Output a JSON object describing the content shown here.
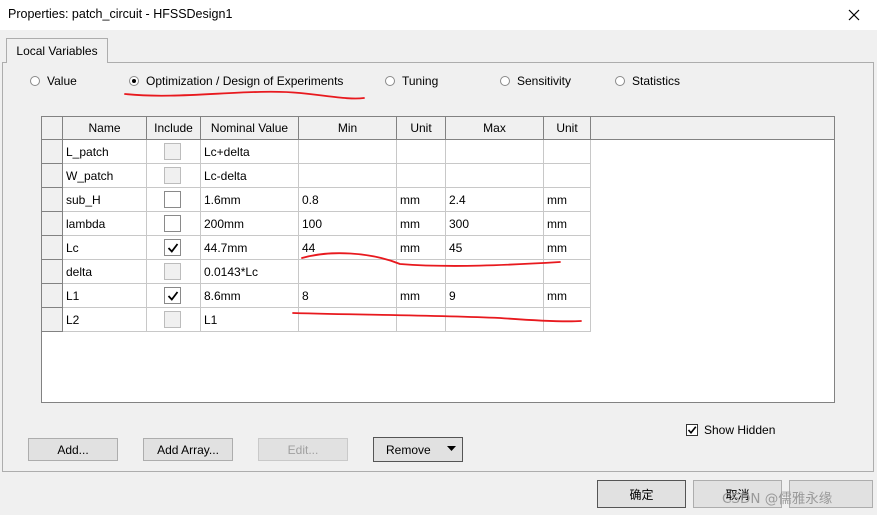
{
  "window": {
    "title": "Properties: patch_circuit - HFSSDesign1"
  },
  "tabs": [
    {
      "label": "Local Variables",
      "active": true
    }
  ],
  "modes": [
    {
      "label": "Value",
      "selected": false
    },
    {
      "label": "Optimization / Design of Experiments",
      "selected": true
    },
    {
      "label": "Tuning",
      "selected": false
    },
    {
      "label": "Sensitivity",
      "selected": false
    },
    {
      "label": "Statistics",
      "selected": false
    }
  ],
  "table": {
    "columns": [
      "Name",
      "Include",
      "Nominal Value",
      "Min",
      "Unit",
      "Max",
      "Unit"
    ],
    "rows": [
      {
        "name": "L_patch",
        "include": false,
        "include_enabled": false,
        "nominal": "Lc+delta",
        "min": "",
        "min_unit": "",
        "max": "",
        "max_unit": ""
      },
      {
        "name": "W_patch",
        "include": false,
        "include_enabled": false,
        "nominal": "Lc-delta",
        "min": "",
        "min_unit": "",
        "max": "",
        "max_unit": ""
      },
      {
        "name": "sub_H",
        "include": false,
        "include_enabled": true,
        "nominal": "1.6mm",
        "min": "0.8",
        "min_unit": "mm",
        "max": "2.4",
        "max_unit": "mm"
      },
      {
        "name": "lambda",
        "include": false,
        "include_enabled": true,
        "nominal": "200mm",
        "min": "100",
        "min_unit": "mm",
        "max": "300",
        "max_unit": "mm"
      },
      {
        "name": "Lc",
        "include": true,
        "include_enabled": true,
        "nominal": "44.7mm",
        "min": "44",
        "min_unit": "mm",
        "max": "45",
        "max_unit": "mm"
      },
      {
        "name": "delta",
        "include": false,
        "include_enabled": false,
        "nominal": "0.0143*Lc",
        "min": "",
        "min_unit": "",
        "max": "",
        "max_unit": ""
      },
      {
        "name": "L1",
        "include": true,
        "include_enabled": true,
        "nominal": "8.6mm",
        "min": "8",
        "min_unit": "mm",
        "max": "9",
        "max_unit": "mm"
      },
      {
        "name": "L2",
        "include": false,
        "include_enabled": false,
        "nominal": "L1",
        "min": "",
        "min_unit": "",
        "max": "",
        "max_unit": ""
      }
    ]
  },
  "show_hidden": {
    "label": "Show Hidden",
    "checked": true
  },
  "buttons": {
    "add": "Add...",
    "add_array": "Add Array...",
    "edit": "Edit...",
    "remove": "Remove",
    "ok": "确定",
    "cancel": "取消"
  },
  "watermark": "CSDN @儒雅永缘",
  "colors": {
    "annotation": "#e8191e",
    "grid_line": "#c8c8c8",
    "dialog_bg": "#f0f0f0"
  }
}
